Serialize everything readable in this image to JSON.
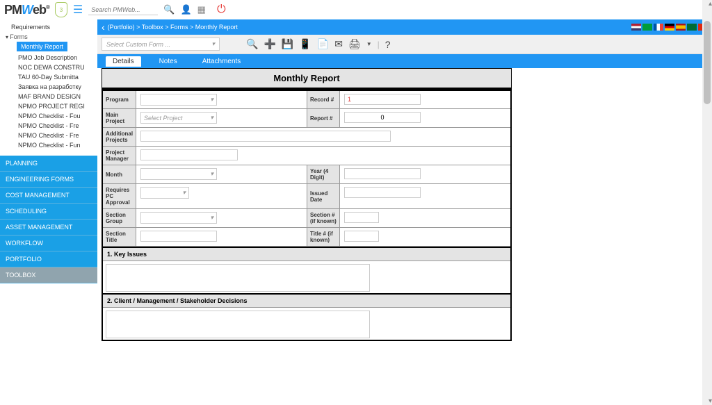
{
  "header": {
    "logo_prefix": "PM",
    "logo_mid": "W",
    "logo_suffix": "eb",
    "shield_count": "3",
    "search_placeholder": "Search PMWeb..."
  },
  "breadcrumb": "(Portfolio) > Toolbox > Forms > Monthly Report",
  "toolbar": {
    "form_selector": "Select Custom Form ..."
  },
  "subtabs": {
    "details": "Details",
    "notes": "Notes",
    "attachments": "Attachments"
  },
  "tree": {
    "req": "Requirements",
    "forms": "Forms",
    "items": [
      "Monthly Report",
      "PMO Job Description",
      "NOC DEWA CONSTRU",
      "TAU 60-Day Submitta",
      "Заявка на разработку",
      "MAF BRAND DESIGN",
      "NPMO PROJECT REGI",
      "NPMO Checklist - Fou",
      "NPMO Checklist - Fre",
      "NPMO Checklist - Fre",
      "NPMO Checklist - Fun"
    ]
  },
  "modules": [
    "PLANNING",
    "ENGINEERING FORMS",
    "COST MANAGEMENT",
    "SCHEDULING",
    "ASSET MANAGEMENT",
    "WORKFLOW",
    "PORTFOLIO",
    "TOOLBOX"
  ],
  "form": {
    "title": "Monthly Report",
    "labels": {
      "program": "Program",
      "record": "Record #",
      "main_project": "Main Project",
      "report": "Report #",
      "additional": "Additional Projects",
      "pm": "Project Manager",
      "month": "Month",
      "year": "Year (4 Digit)",
      "approval": "Requires PC Approval",
      "issued": "Issued Date",
      "sec_group": "Section Group",
      "sec_num": "Section # (if known)",
      "sec_title": "Section Title",
      "title_known": "Title # (if known)"
    },
    "values": {
      "select_project": "Select Project",
      "record_val": "1",
      "report_val": "0"
    },
    "sections": {
      "s1": "1. Key Issues",
      "s2": "2. Client / Management / Stakeholder Decisions"
    }
  }
}
